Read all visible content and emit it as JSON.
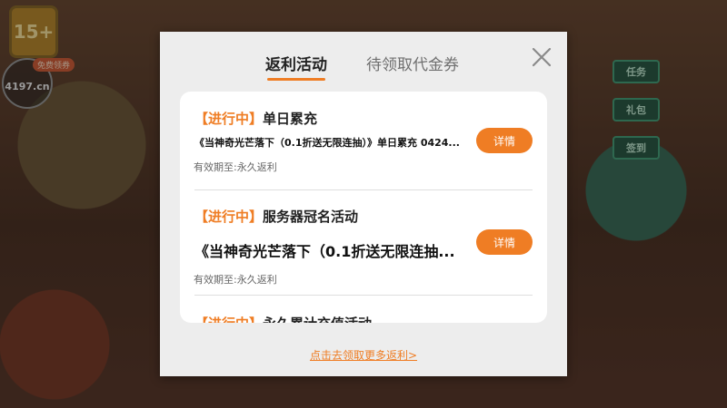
{
  "background": {
    "corner_badge": "15+",
    "logo_text": "4197.cn",
    "free_pill": "免费领券",
    "side_buttons": [
      "任务",
      "礼包",
      "签到"
    ]
  },
  "modal": {
    "tabs": [
      {
        "label": "返利活动",
        "active": true
      },
      {
        "label": "待领取代金券",
        "active": false
      }
    ],
    "close_icon": "close-icon",
    "items": [
      {
        "tag": "【进行中】",
        "title": "单日累充",
        "description": "《当神奇光芒落下（0.1折送无限连抽）》单日累充  0424...",
        "validity": "有效期至:永久返利",
        "button": "详情"
      },
      {
        "tag": "【进行中】",
        "title": "服务器冠名活动",
        "description": "《当神奇光芒落下（0.1折送无限连抽...",
        "validity": "有效期至:永久返利",
        "button": "详情"
      },
      {
        "tag": "【进行中】",
        "title": "永久累计充值活动"
      }
    ],
    "more_link": "点击去领取更多返利>"
  },
  "colors": {
    "accent": "#ef7d24",
    "modal_bg": "#ededed",
    "panel_bg": "#ffffff"
  }
}
